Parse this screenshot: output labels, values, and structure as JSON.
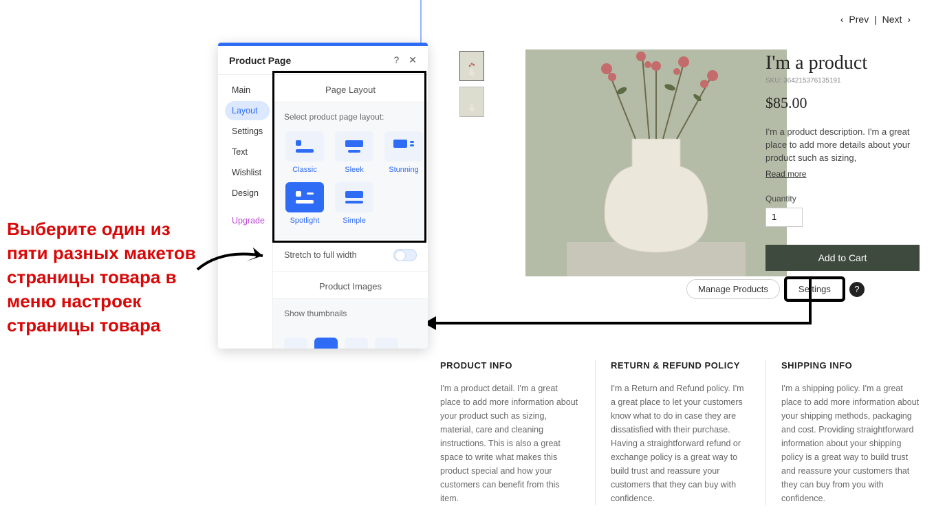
{
  "nav": {
    "prev": "Prev",
    "next": "Next",
    "sep": "|",
    "chev_l": "‹",
    "chev_r": "›"
  },
  "product": {
    "title": "I'm a product",
    "sku_label": "SKU:",
    "sku": "364215376135191",
    "price": "$85.00",
    "description": "I'm a product description. I'm a great place to add more details about your product such as sizing,",
    "read_more": "Read more",
    "qty_label": "Quantity",
    "qty_value": "1",
    "add_cart": "Add to Cart"
  },
  "actions": {
    "manage": "Manage Products",
    "settings": "Settings",
    "help": "?"
  },
  "info": {
    "c1": {
      "h": "PRODUCT INFO",
      "p": "I'm a product detail. I'm a great place to add more information about your product such as sizing, material, care and cleaning instructions. This is also a great space to write what makes this product special and how your customers can benefit from this item."
    },
    "c2": {
      "h": "RETURN & REFUND POLICY",
      "p": "I'm a Return and Refund policy. I'm a great place to let your customers know what to do in case they are dissatisfied with their purchase. Having a straightforward refund or exchange policy is a great way to build trust and reassure your customers that they can buy with confidence."
    },
    "c3": {
      "h": "SHIPPING INFO",
      "p": "I'm a shipping policy. I'm a great place to add more information about your shipping methods, packaging and cost. Providing straightforward information about your shipping policy is a great way to build trust and reassure your customers that they can buy from you with confidence."
    }
  },
  "panel": {
    "title": "Product Page",
    "help": "?",
    "close": "✕",
    "tabs": {
      "main": "Main",
      "layout": "Layout",
      "settings": "Settings",
      "text": "Text",
      "wishlist": "Wishlist",
      "design": "Design",
      "upgrade": "Upgrade"
    },
    "page_layout": {
      "header": "Page Layout",
      "prompt": "Select product page layout:",
      "opts": [
        "Classic",
        "Sleek",
        "Stunning",
        "Spotlight",
        "Simple"
      ]
    },
    "stretch": "Stretch to full width",
    "prod_images": {
      "header": "Product Images",
      "show_thumbs": "Show thumbnails"
    }
  },
  "annotation": "Выберите один из пяти разных макетов страницы товара в меню настроек страницы товара"
}
